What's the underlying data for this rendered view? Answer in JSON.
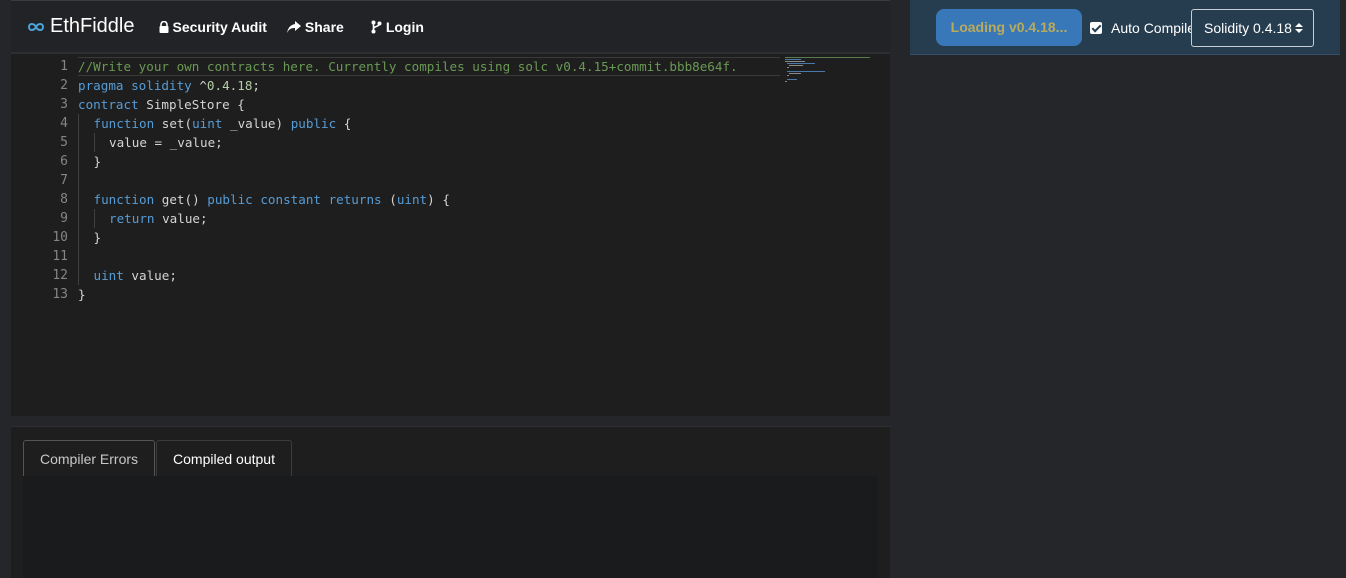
{
  "navbar": {
    "brand": "EthFiddle",
    "security_audit": "Security Audit",
    "share": "Share",
    "login": "Login"
  },
  "editor": {
    "line_numbers": [
      "1",
      "2",
      "3",
      "4",
      "5",
      "6",
      "7",
      "8",
      "9",
      "10",
      "11",
      "12",
      "13"
    ],
    "lines": {
      "l1": "//Write your own contracts here. Currently compiles using solc v0.4.15+commit.bbb8e64f.",
      "l2_a": "pragma solidity",
      "l2_b": " ^",
      "l2_c": "0.4.18",
      "l2_d": ";",
      "l3_a": "contract",
      "l3_b": " SimpleStore {",
      "l4_a": "function",
      "l4_b": " set(",
      "l4_c": "uint",
      "l4_d": " _value) ",
      "l4_e": "public",
      "l4_f": " {",
      "l5": "value = _value;",
      "l6": "}",
      "l8_a": "function",
      "l8_b": " get() ",
      "l8_c": "public constant returns",
      "l8_d": " (",
      "l8_e": "uint",
      "l8_f": ") {",
      "l9_a": "return",
      "l9_b": " value;",
      "l10": "}",
      "l12_a": "uint",
      "l12_b": " value;",
      "l13": "}"
    }
  },
  "output": {
    "tabs": [
      {
        "label": "Compiler Errors",
        "active": true
      },
      {
        "label": "Compiled output",
        "active": false
      }
    ]
  },
  "toolbar": {
    "loading_label": "Loading v0.4.18...",
    "auto_compile_label": "Auto Compile",
    "auto_compile_checked": true,
    "compiler_select_value": "Solidity 0.4.18"
  },
  "colors": {
    "keyword": "#569cd6",
    "comment": "#6a9955",
    "number": "#b5cea8",
    "loading_button": "#3978b8",
    "right_toolbar": "#263c4f"
  }
}
